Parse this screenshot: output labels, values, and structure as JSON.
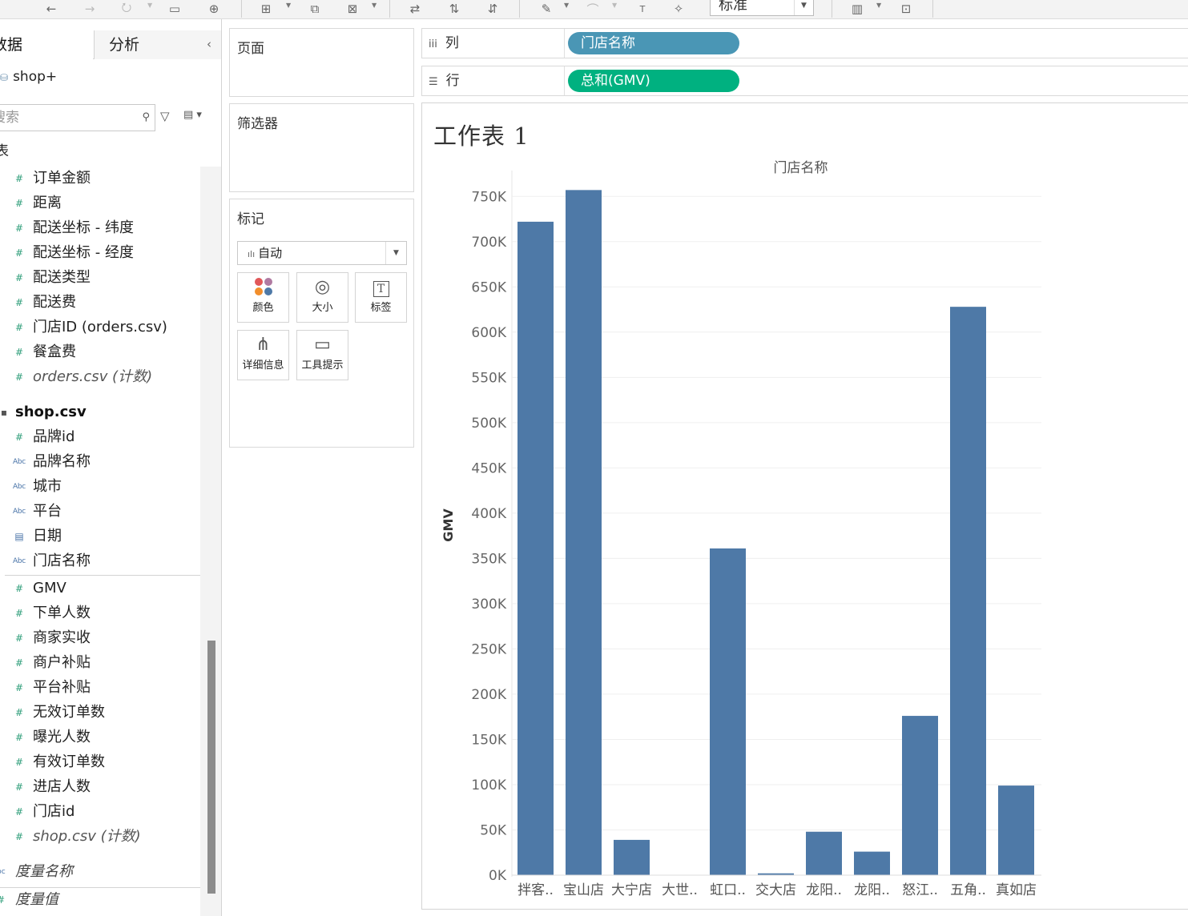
{
  "toolbar": {
    "view_mode": "标准",
    "icons": [
      "back-arrow-icon",
      "forward-arrow-icon",
      "redo-icon",
      "save-icon",
      "new-datasource-icon",
      "new-worksheet-icon",
      "duplicate-icon",
      "clear-icon",
      "swap-icon",
      "sort-ascending-icon",
      "sort-descending-icon",
      "highlight-icon",
      "group-icon",
      "label-icon",
      "pin-icon",
      "show-me-icon",
      "presentation-icon"
    ]
  },
  "left_pane": {
    "tab_data": "数据",
    "tab_analysis": "分析",
    "collapse": "‹",
    "datasource": "shop+",
    "search_placeholder": "搜索",
    "tables_heading": "表",
    "orders_fields": [
      {
        "type": "measure",
        "label": "订单金额"
      },
      {
        "type": "measure",
        "label": "距离"
      },
      {
        "type": "measure",
        "label": "配送坐标 - 纬度"
      },
      {
        "type": "measure",
        "label": "配送坐标 - 经度"
      },
      {
        "type": "measure",
        "label": "配送类型"
      },
      {
        "type": "measure",
        "label": "配送费"
      },
      {
        "type": "measure",
        "label": "门店ID (orders.csv)"
      },
      {
        "type": "measure",
        "label": "餐盒费"
      },
      {
        "type": "calc",
        "label": "orders.csv (计数)"
      }
    ],
    "shop_table": "shop.csv",
    "shop_dimensions": [
      {
        "type": "measure",
        "label": "品牌id"
      },
      {
        "type": "abc",
        "label": "品牌名称"
      },
      {
        "type": "abc",
        "label": "城市"
      },
      {
        "type": "abc",
        "label": "平台"
      },
      {
        "type": "date",
        "label": "日期"
      },
      {
        "type": "abc",
        "label": "门店名称"
      }
    ],
    "shop_measures": [
      {
        "type": "measure",
        "label": "GMV"
      },
      {
        "type": "measure",
        "label": "下单人数"
      },
      {
        "type": "measure",
        "label": "商家实收"
      },
      {
        "type": "measure",
        "label": "商户补贴"
      },
      {
        "type": "measure",
        "label": "平台补贴"
      },
      {
        "type": "measure",
        "label": "无效订单数"
      },
      {
        "type": "measure",
        "label": "曝光人数"
      },
      {
        "type": "measure",
        "label": "有效订单数"
      },
      {
        "type": "measure",
        "label": "进店人数"
      },
      {
        "type": "measure",
        "label": "门店id"
      },
      {
        "type": "calc",
        "label": "shop.csv (计数)"
      }
    ],
    "measure_names": "度量名称",
    "measure_values": "度量值"
  },
  "pages_card": {
    "title": "页面"
  },
  "filters_card": {
    "title": "筛选器"
  },
  "marks_card": {
    "title": "标记",
    "mark_type": "自动",
    "buttons": [
      "颜色",
      "大小",
      "标签",
      "详细信息",
      "工具提示"
    ]
  },
  "shelves": {
    "columns_label": "列",
    "columns_pill": "门店名称",
    "rows_label": "行",
    "rows_pill": "总和(GMV)"
  },
  "sheet": {
    "title": "工作表 1"
  },
  "chart_data": {
    "type": "bar",
    "header": "门店名称",
    "ylabel": "GMV",
    "ylim": [
      0,
      775000
    ],
    "yticks": [
      0,
      50000,
      100000,
      150000,
      200000,
      250000,
      300000,
      350000,
      400000,
      450000,
      500000,
      550000,
      600000,
      650000,
      700000,
      750000
    ],
    "ytick_labels": [
      "0K",
      "50K",
      "100K",
      "150K",
      "200K",
      "250K",
      "300K",
      "350K",
      "400K",
      "450K",
      "500K",
      "550K",
      "600K",
      "650K",
      "700K",
      "750K"
    ],
    "categories": [
      "拌客..",
      "宝山店",
      "大宁店",
      "大世..",
      "虹口..",
      "交大店",
      "龙阳..",
      "龙阳..",
      "怒江..",
      "五角..",
      "真如店"
    ],
    "values": [
      722000,
      757000,
      39000,
      0,
      361000,
      2000,
      48000,
      26000,
      176000,
      628000,
      99000
    ],
    "bar_color": "#4e79a7",
    "grid": true
  }
}
